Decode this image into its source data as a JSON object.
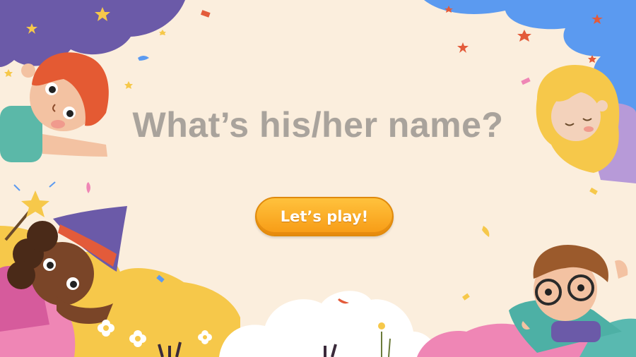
{
  "title": "What’s his/her name?",
  "play_button": {
    "label": "Let’s play!"
  },
  "colors": {
    "background": "#fbeedd",
    "title_text": "#a9a39c",
    "button_top": "#ffc23d",
    "button_bottom": "#f79a14",
    "cloud_purple": "#6b5aa8",
    "cloud_blue": "#5b9af0",
    "hill_yellow": "#f6c84a",
    "hill_pink": "#ef86b5",
    "cloud_white": "#ffffff"
  },
  "decor": {
    "characters": [
      "red-haired-boy",
      "blonde-girl",
      "witch-girl",
      "boy-with-glasses"
    ],
    "icons": [
      "star-icon",
      "confetti-icon",
      "flower-icon",
      "magic-wand-icon",
      "witch-hat-icon"
    ]
  }
}
